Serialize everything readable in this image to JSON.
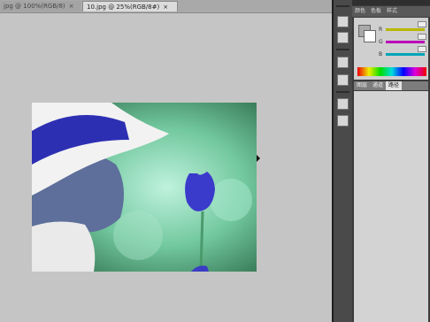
{
  "tabs": [
    {
      "label": "jpg @ 100%(RGB/8)",
      "close": "×"
    },
    {
      "label": "10.jpg @ 25%(RGB/8#)",
      "close": "×"
    }
  ],
  "color_panel": {
    "tabs": [
      "颜色",
      "色板",
      "样式"
    ],
    "rows": [
      {
        "label": "R",
        "color": "#b8b800"
      },
      {
        "label": "G",
        "color": "#b800b8"
      },
      {
        "label": "B",
        "color": "#00a5b8"
      }
    ]
  },
  "layer_panel": {
    "tabs": [
      "图层",
      "通道",
      "路径"
    ],
    "active": 2
  },
  "colors": {
    "panel_dark": "#3b3b3b",
    "canvas": "#c5c5c5"
  }
}
